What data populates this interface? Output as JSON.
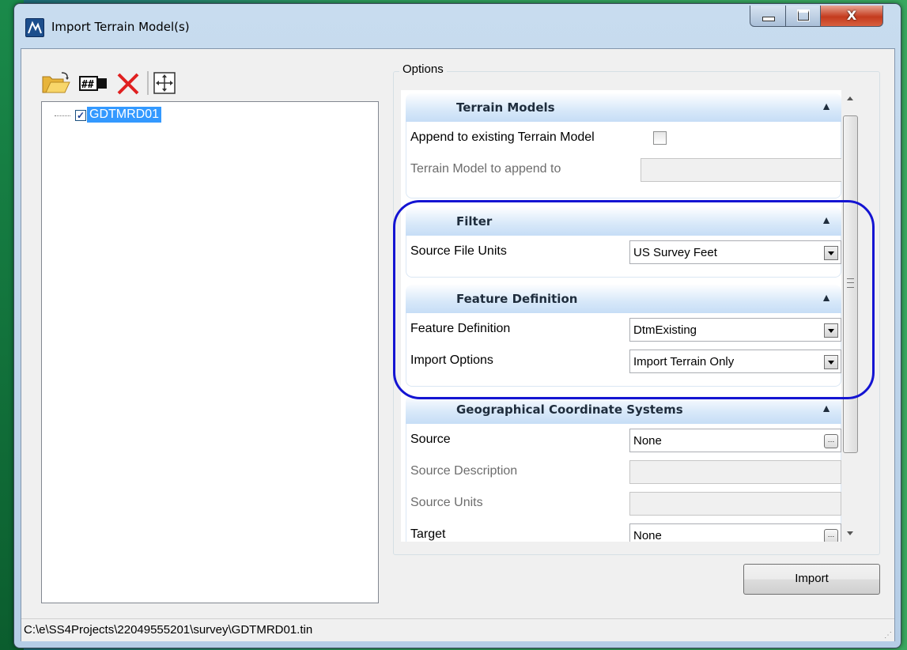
{
  "window": {
    "title": "Import Terrain Model(s)",
    "controls": {
      "minimize": "minimize",
      "maximize": "maximize",
      "close": "X"
    }
  },
  "toolbar": {
    "icons": [
      "open-folder-icon",
      "grid-icon",
      "delete-icon",
      "fit-view-icon"
    ]
  },
  "tree": {
    "items": [
      {
        "label": "GDTMRD01",
        "checked": true,
        "selected": true
      }
    ]
  },
  "options": {
    "title": "Options",
    "sections": [
      {
        "title": "Terrain Models",
        "rows": [
          {
            "label": "Append to existing Terrain Model",
            "type": "checkbox",
            "checked": false
          },
          {
            "label": "Terrain Model to append to",
            "type": "text",
            "value": "",
            "disabled": true
          }
        ]
      },
      {
        "title": "Filter",
        "rows": [
          {
            "label": "Source File Units",
            "type": "combo",
            "value": "US Survey Feet"
          }
        ]
      },
      {
        "title": "Feature Definition",
        "rows": [
          {
            "label": "Feature Definition",
            "type": "combo",
            "value": "DtmExisting"
          },
          {
            "label": "Import Options",
            "type": "combo",
            "value": "Import Terrain Only"
          }
        ]
      },
      {
        "title": "Geographical Coordinate Systems",
        "rows": [
          {
            "label": "Source",
            "type": "browse",
            "value": "None"
          },
          {
            "label": "Source Description",
            "type": "text",
            "value": "",
            "disabled": true
          },
          {
            "label": "Source Units",
            "type": "text",
            "value": "",
            "disabled": true
          },
          {
            "label": "Target",
            "type": "browse",
            "value": "None"
          }
        ]
      }
    ]
  },
  "buttons": {
    "import": "Import"
  },
  "status": {
    "path": "C:\\e\\SS4Projects\\22049555201\\survey\\GDTMRD01.tin"
  },
  "colors": {
    "highlight_oval": "#1414d2",
    "selection": "#3399ff",
    "section_header": "#d7e8f9"
  }
}
